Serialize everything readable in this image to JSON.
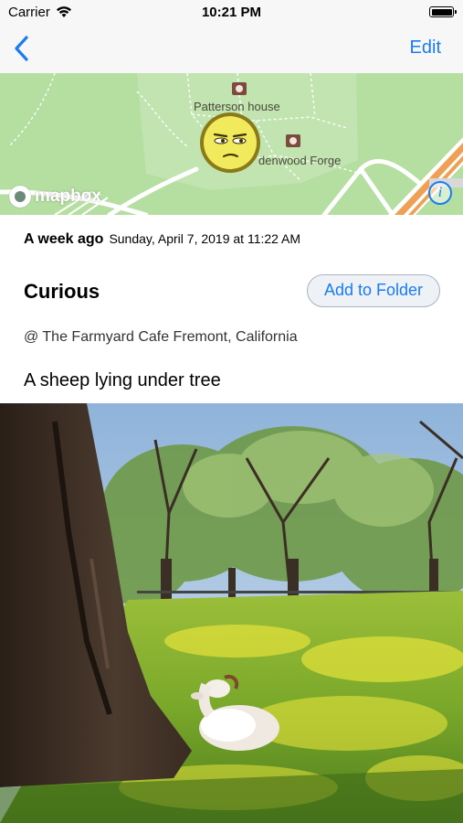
{
  "status_bar": {
    "carrier": "Carrier",
    "time": "10:21 PM"
  },
  "nav": {
    "back_icon": "chevron-left-icon",
    "edit_label": "Edit"
  },
  "map": {
    "labels": {
      "patterson": "Patterson house",
      "forge": "denwood Forge"
    },
    "attribution": "mapbox",
    "info_glyph": "i",
    "mood_icon": "unamused-face"
  },
  "entry": {
    "relative_date": "A week ago",
    "full_date": "Sunday, April 7, 2019 at 11:22 AM",
    "mood": "Curious",
    "folder_button": "Add to Folder",
    "location": "@ The Farmyard Cafe Fremont, California",
    "note": "A sheep lying under tree"
  },
  "colors": {
    "accent": "#1a7cf2",
    "map_green": "#b5dea1",
    "highway": "#f0a055"
  }
}
